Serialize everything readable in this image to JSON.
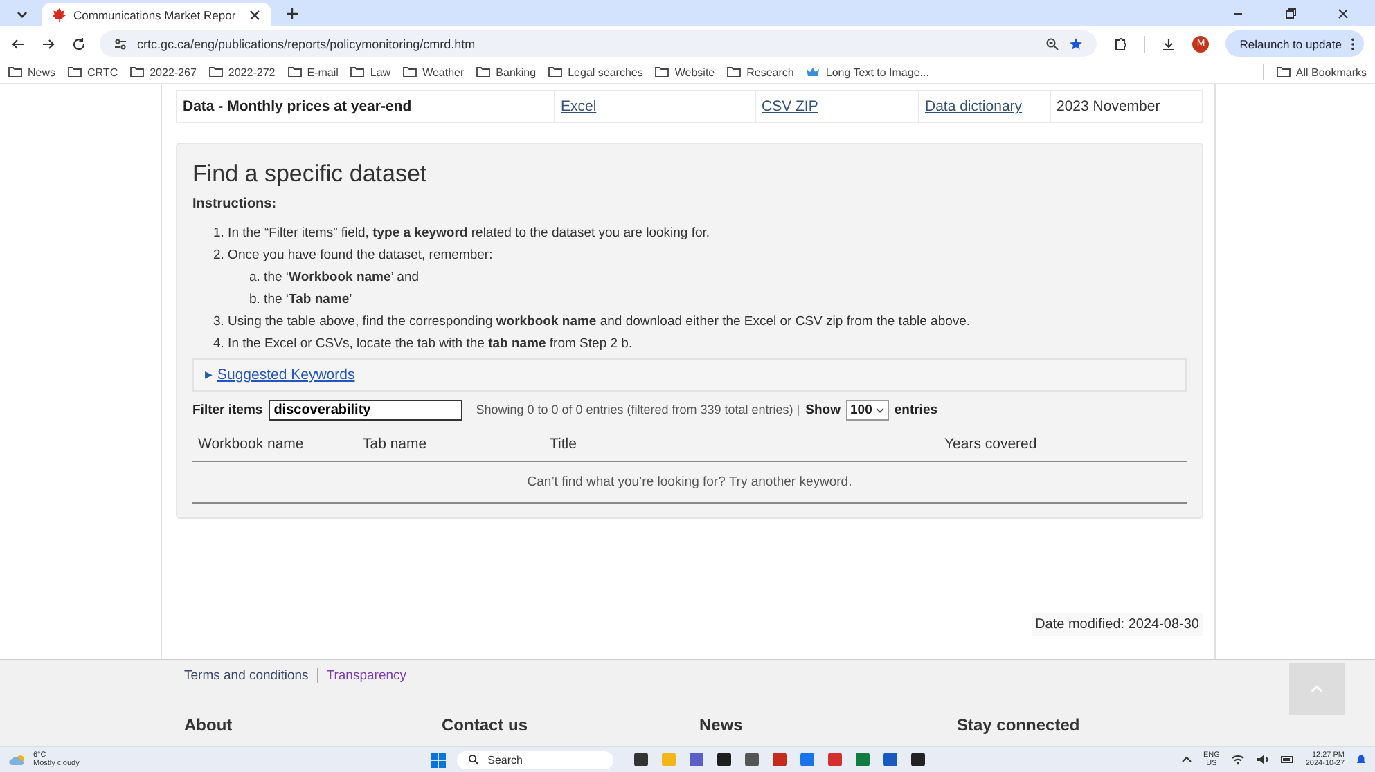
{
  "browser": {
    "tab_title": "Communications Market Repor",
    "url": "crtc.gc.ca/eng/publications/reports/policymonitoring/cmrd.htm",
    "avatar": "M",
    "relaunch": "Relaunch to update",
    "bookmarks": [
      {
        "label": "News",
        "kind": "folder"
      },
      {
        "label": "CRTC",
        "kind": "folder"
      },
      {
        "label": "2022-267",
        "kind": "folder"
      },
      {
        "label": "2022-272",
        "kind": "folder"
      },
      {
        "label": "E-mail",
        "kind": "folder"
      },
      {
        "label": "Law",
        "kind": "folder"
      },
      {
        "label": "Weather",
        "kind": "folder"
      },
      {
        "label": "Banking",
        "kind": "folder"
      },
      {
        "label": "Legal searches",
        "kind": "folder"
      },
      {
        "label": "Website",
        "kind": "folder"
      },
      {
        "label": "Research",
        "kind": "folder"
      },
      {
        "label": "Long Text to Image...",
        "kind": "app"
      }
    ],
    "all_bookmarks": "All Bookmarks"
  },
  "data_row": {
    "title": "Data - Monthly prices at year-end",
    "excel": "Excel",
    "csv": "CSV ZIP",
    "dictionary": "Data dictionary",
    "period": "2023 November"
  },
  "dataset": {
    "heading": "Find a specific dataset",
    "instructions_label": "Instructions:",
    "steps": [
      {
        "text": "1. In the “Filter items” field, **type a keyword** related to the dataset you are looking for."
      },
      {
        "text": "2. Once you have found the dataset, remember:",
        "children": [
          {
            "text": "a. the ‘**Workbook name**’ and"
          },
          {
            "text": "b. the ‘**Tab name**’"
          }
        ]
      },
      {
        "text": "3. Using the table above, find the corresponding **workbook name** and download either the Excel or CSV zip from the table above."
      },
      {
        "text": "4. In the Excel or CSVs, locate the tab with the **tab name** from Step 2 b."
      }
    ],
    "suggested": {
      "toggle": "▶",
      "label": "Suggested Keywords"
    },
    "filter": {
      "label": "Filter items",
      "value": "discoverability",
      "summary": "Showing 0 to 0 of 0 entries (filtered from 339 total entries) |",
      "show": "Show",
      "page_size": "100",
      "entries": "entries"
    },
    "columns": [
      "Workbook name",
      "Tab name",
      "Title",
      "Years covered"
    ],
    "empty_message": "Can’t find what you’re looking for? Try another keyword."
  },
  "date_modified": "Date modified: 2024-08-30",
  "footer": {
    "links": [
      "Terms and conditions",
      "Transparency"
    ],
    "headings": [
      "About",
      "Contact us",
      "News",
      "Stay connected"
    ]
  },
  "taskbar": {
    "temperature": "6°C",
    "weather": "Mostly cloudy",
    "search": "Search",
    "language": "ENG",
    "region": "US",
    "time": "12:27 PM",
    "date": "2024-10-27"
  }
}
